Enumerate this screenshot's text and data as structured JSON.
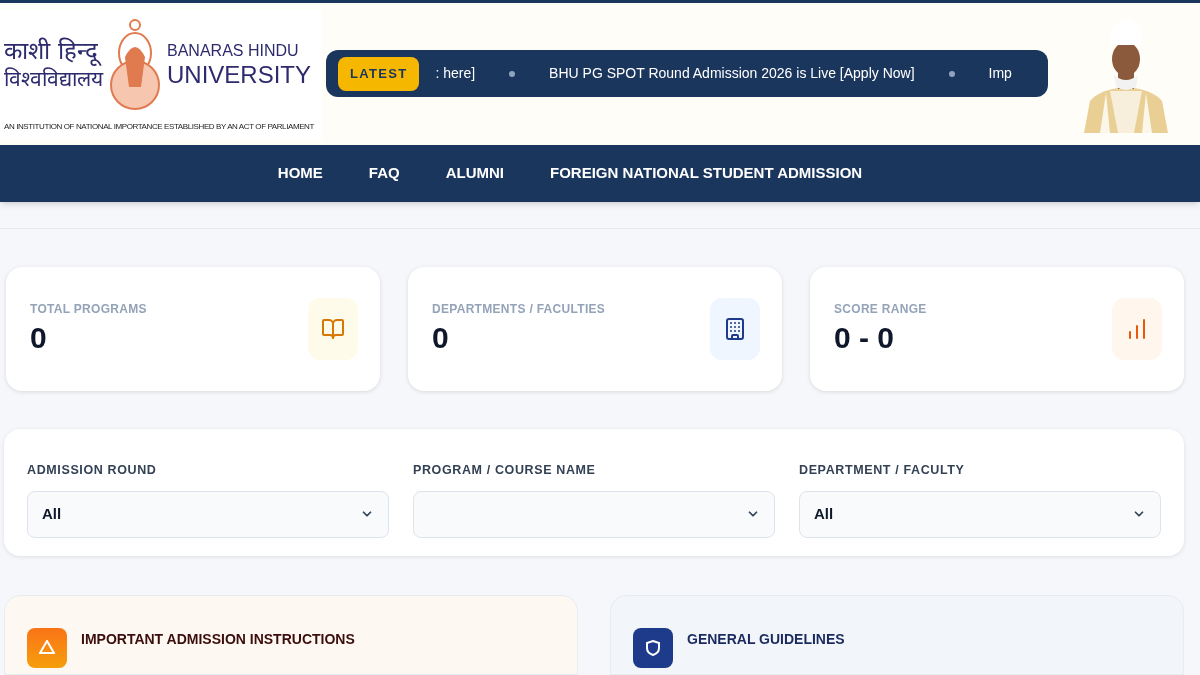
{
  "header": {
    "logo_hindi_line1": "काशी हिन्दू",
    "logo_hindi_line2": "विश्वविद्यालय",
    "logo_english_line1": "BANARAS HINDU",
    "logo_english_line2": "UNIVERSITY",
    "tagline": "AN INSTITUTION OF NATIONAL IMPORTANCE ESTABLISHED BY AN ACT OF PARLIAMENT"
  },
  "ticker": {
    "badge": "LATEST",
    "items": [
      ": here]",
      "BHU PG SPOT Round Admission 2026 is Live [Apply Now]",
      "Imp"
    ]
  },
  "nav": [
    "HOME",
    "FAQ",
    "ALUMNI",
    "FOREIGN NATIONAL STUDENT ADMISSION"
  ],
  "stats": [
    {
      "label": "TOTAL PROGRAMS",
      "value": "0",
      "kind": "book",
      "color": "#d97706"
    },
    {
      "label": "DEPARTMENTS / FACULTIES",
      "value": "0",
      "kind": "building",
      "color": "#1e3a8a"
    },
    {
      "label": "SCORE RANGE",
      "value": "0 - 0",
      "kind": "chart",
      "color": "#ea580c"
    }
  ],
  "filters": [
    {
      "label": "ADMISSION ROUND",
      "value": "All"
    },
    {
      "label": "PROGRAM / COURSE NAME"
    },
    {
      "label": "DEPARTMENT / FACULTY",
      "value": "All"
    }
  ],
  "info_cards": [
    {
      "title": "IMPORTANT ADMISSION INSTRUCTIONS",
      "kind": "warning"
    },
    {
      "title": "GENERAL GUIDELINES",
      "kind": "shield"
    }
  ]
}
